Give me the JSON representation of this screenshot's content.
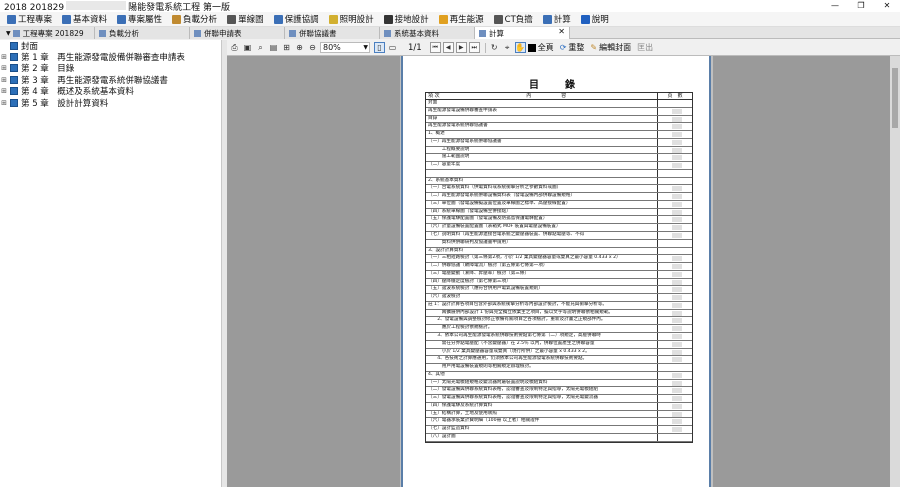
{
  "window": {
    "title_prefix": "2018 201829",
    "title_suffix": "陽能發電系統工程 第一版",
    "controls": [
      "—",
      "❐",
      "✕"
    ]
  },
  "menu": [
    {
      "label": "工程專案",
      "icon_color": "#3b6fb6"
    },
    {
      "label": "基本資料",
      "icon_color": "#3b6fb6"
    },
    {
      "label": "專案屬性",
      "icon_color": "#3b6fb6"
    },
    {
      "label": "負載分析",
      "icon_color": "#c08a30"
    },
    {
      "label": "單線圖",
      "icon_color": "#555555"
    },
    {
      "label": "保護協調",
      "icon_color": "#3b6fb6"
    },
    {
      "label": "照明設計",
      "icon_color": "#d2b030"
    },
    {
      "label": "接地設計",
      "icon_color": "#333333"
    },
    {
      "label": "再生能源",
      "icon_color": "#e0a020"
    },
    {
      "label": "CT負擔",
      "icon_color": "#555555"
    },
    {
      "label": "計算",
      "icon_color": "#3b6fb6"
    },
    {
      "label": "說明",
      "icon_color": "#2060c0"
    }
  ],
  "tabs": [
    {
      "label": "工程專案 201829",
      "active": false
    },
    {
      "label": "負載分析",
      "active": false
    },
    {
      "label": "併聯申請表",
      "active": false
    },
    {
      "label": "併聯協議書",
      "active": false
    },
    {
      "label": "系統基本資料",
      "active": false
    },
    {
      "label": "計算",
      "active": true
    }
  ],
  "tree": [
    {
      "label": "封面",
      "toggle": ""
    },
    {
      "label": "第 1 章　再生能源發電設備併聯審查申請表",
      "toggle": "⊞"
    },
    {
      "label": "第 2 章　目錄",
      "toggle": "⊞"
    },
    {
      "label": "第 3 章　再生能源發電系統併聯協議書",
      "toggle": "⊞"
    },
    {
      "label": "第 4 章　概述及系統基本資料",
      "toggle": "⊞"
    },
    {
      "label": "第 5 章　設計計算資料",
      "toggle": "⊞"
    }
  ],
  "viewer": {
    "zoom": "80%",
    "page": "1/1",
    "full_page": "全頁",
    "redraw": "重整",
    "edit_cover": "編輯封面",
    "exit": "匡出"
  },
  "toc": {
    "title": "目　錄",
    "head": {
      "no": "項 次",
      "content": "內　　　　　　容",
      "page": "頁　數"
    },
    "rows": [
      {
        "text": "封面",
        "blk": false
      },
      {
        "text": "再生能源發電設備併聯審查申請表",
        "blk": true
      },
      {
        "text": "目錄",
        "blk": true
      },
      {
        "text": "再生能源發電系統併聯協議書",
        "blk": true
      },
      {
        "text": "1、概述",
        "blk": true
      },
      {
        "text": "（一）再生能源發電系統併聯協議書",
        "blk": true
      },
      {
        "text": "　　　工程概要說明",
        "blk": true
      },
      {
        "text": "　　　施工範圍說明",
        "blk": true
      },
      {
        "text": "（二）容量年度",
        "blk": true
      },
      {
        "text": "",
        "blk": false
      },
      {
        "text": "2、系統基本資料",
        "blk": false
      },
      {
        "text": "（一）台電系統資料（供電資料或系統衝擊分析之參數資料或圖）",
        "blk": true
      },
      {
        "text": "（二）再生能源發電系統併聯設備資料表（發電設備內部併聯設備規格）",
        "blk": true
      },
      {
        "text": "（三）單位圖（發電設備擬設置位置及單線圖之標準、高壓接線配置）",
        "blk": true
      },
      {
        "text": "（四）系統單線圖（發電設備至併接點）",
        "blk": true
      },
      {
        "text": "（五）保護電驛配置圖（發電設備及防孤島保護電驛配置）",
        "blk": true
      },
      {
        "text": "（六）計量設備裝置配置圖（表箱式 MOF 裝置與電壓設備裝置）",
        "blk": true
      },
      {
        "text": "（七）說明資料（再生能源連接台電系統之變壓器裝置、併聯點電壓等、不得",
        "blk": true
      },
      {
        "text": "　　　資料供併聯研判及協議書申請用）",
        "blk": false
      },
      {
        "text": "3、設計計算資料",
        "blk": false
      },
      {
        "text": "（一）三相短路檢討（第三條第2項，小於 1/2 業具變壓器容量或雙真之最小容量 0.433 x 2）",
        "blk": true
      },
      {
        "text": "（二）併聯協議（故障電流）檢討（第五條第七條第一項）",
        "blk": true
      },
      {
        "text": "（三）電壓變動（漸降、昇壓率）檢討（第三條）",
        "blk": true
      },
      {
        "text": "（四）壓降穩定度檢討（第七條第三項）",
        "blk": true
      },
      {
        "text": "（五）諧波系統檢討（應符合併用戶電氣設備裝置規則）",
        "blk": true
      },
      {
        "text": "（六）諧波檢討",
        "blk": true
      },
      {
        "text": "註 1：設計計算各項目包含外部與系統衝擊分析等內部設計檢討，不能充與衝擊分析等。",
        "blk": true
      },
      {
        "text": "　　　兩擴展併內部設計 1 份與完全獨立依業主之項目，擬以文字等說明併聯依相關規範。",
        "blk": true
      },
      {
        "text": "　　2、發電設備與調整檢討修正依備有關項目之各項檢討，重新及計畫之正規部件內。",
        "blk": true
      },
      {
        "text": "　　　應於工程檢討依規檢討。",
        "blk": true
      },
      {
        "text": "　　3、依本公司再生能源發電系統併聯技術要點第七條第（二）項規定，高壓併聯時",
        "blk": true
      },
      {
        "text": "　　　需在分界點電壓配（不含變壓器）在 2.5％ 以內，併聯位置產生之併聯容量",
        "blk": true
      },
      {
        "text": "　　　小於 1/2 業具變壓器容量或雙真（現行所供）之最小容量 x 0.433 x 2。",
        "blk": true
      },
      {
        "text": "　　4、各技術之計算應通用，仍須依本公司再生能源發電系統併聯技術要點。",
        "blk": true
      },
      {
        "text": "　　　用戶用電設備裝置規則等相關規定辦理檢討。",
        "blk": false
      },
      {
        "text": "4、其他",
        "blk": true
      },
      {
        "text": "（一）太陽光電模組規格及變流器附屬裝置說明及模組資料",
        "blk": true
      },
      {
        "text": "（二）發電設備與併聯系統資料表格，認證審查及限制特定與指導，太陽光電模組組",
        "blk": true
      },
      {
        "text": "（三）發電設備與併聯系統資料表格，認證審查及限制特定與指導，太陽光電變流器",
        "blk": true
      },
      {
        "text": "（四）保護電驛及系統計算資料",
        "blk": true
      },
      {
        "text": "（五）結構計算，土地及使用執照",
        "blk": true
      },
      {
        "text": "（六）電器承裝業計費明細（100冊 以上者）相關證件",
        "blk": true
      },
      {
        "text": "（七）設計監造資料",
        "blk": true
      },
      {
        "text": "（八）設計圖",
        "blk": false
      }
    ]
  }
}
